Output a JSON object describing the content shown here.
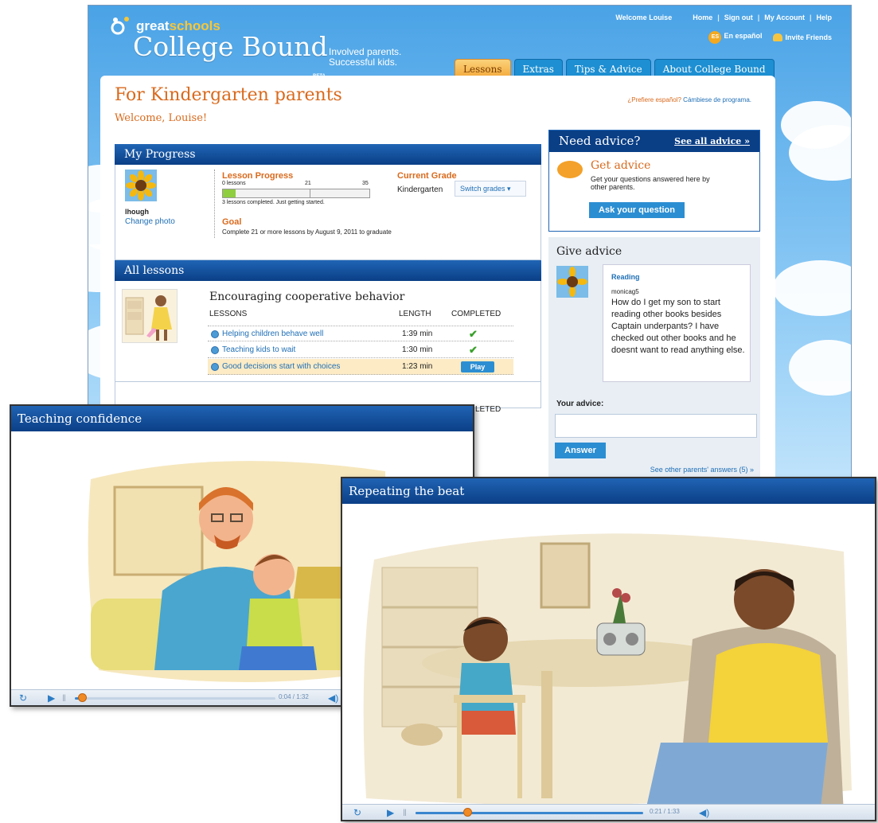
{
  "site": {
    "logo_brand_prefix": "great",
    "logo_brand_suffix": "schools",
    "logo_product": "College Bound",
    "logo_tagline": "Involved parents. Successful kids.",
    "logo_beta": "BETA",
    "top_links": {
      "welcome": "Welcome Louise",
      "home": "Home",
      "sign_out": "Sign out",
      "account": "My Account",
      "help": "Help",
      "es_badge": "ES",
      "espanol": "En español",
      "invite": "Invite Friends"
    },
    "tabs": [
      "Lessons",
      "Extras",
      "Tips & Advice",
      "About College Bound"
    ],
    "active_tab": "Lessons"
  },
  "page": {
    "title": "For Kindergarten parents",
    "welcome": "Welcome, Louise!",
    "switch_lang_q": "¿Prefiere español?",
    "switch_lang_link": "Cámbiese de programa."
  },
  "progress": {
    "header": "My Progress",
    "username": "lhough",
    "change_photo": "Change photo",
    "lesson_progress_title": "Lesson Progress",
    "scale_start": "0 lessons",
    "scale_mid": "21",
    "scale_end": "35",
    "completed_count": 3,
    "total_lessons": 35,
    "note": "3 lessons completed. Just getting started.",
    "goal_title": "Goal",
    "goal_text": "Complete 21 or more lessons by August 9, 2011 to graduate",
    "grade_title": "Current Grade",
    "grade_value": "Kindergarten",
    "switch_grades": "Switch grades ▾"
  },
  "lessons": {
    "header": "All lessons",
    "group_title": "Encouraging cooperative behavior",
    "col_lessons": "LESSONS",
    "col_length": "LENGTH",
    "col_completed": "COMPLETED",
    "col_completed_partial": "LETED",
    "rows": [
      {
        "name": "Helping children behave well",
        "length": "1:39 min",
        "status": "✔"
      },
      {
        "name": "Teaching kids to wait",
        "length": "1:30 min",
        "status": "✔"
      },
      {
        "name": "Good decisions start with choices",
        "length": "1:23 min",
        "status": "Play"
      }
    ]
  },
  "advice": {
    "need_title": "Need advice?",
    "see_all": "See all advice »",
    "get_title": "Get advice",
    "get_desc": "Get your questions answered here by other parents.",
    "ask_btn": "Ask your question",
    "give_title": "Give advice",
    "topic": "Reading",
    "user": "monicag5",
    "question": "How do I get my son to start reading other books besides Captain underpants? I have checked out other books and he doesnt want to read anything else.",
    "your_advice": "Your advice:",
    "answer_btn": "Answer",
    "see_other": "See other parents' answers (5) »"
  },
  "videos": [
    {
      "title": "Teaching confidence",
      "time": "0:04 / 1:32",
      "progress": 0.04
    },
    {
      "title": "Repeating the beat",
      "time": "0:21 / 1:33",
      "progress": 0.23
    }
  ],
  "colors": {
    "accent_orange": "#d96a1d",
    "header_blue": "#0a3f86",
    "link_blue": "#1f6fb6",
    "progress_green": "#8fce3f",
    "knob_orange": "#f08a24"
  }
}
